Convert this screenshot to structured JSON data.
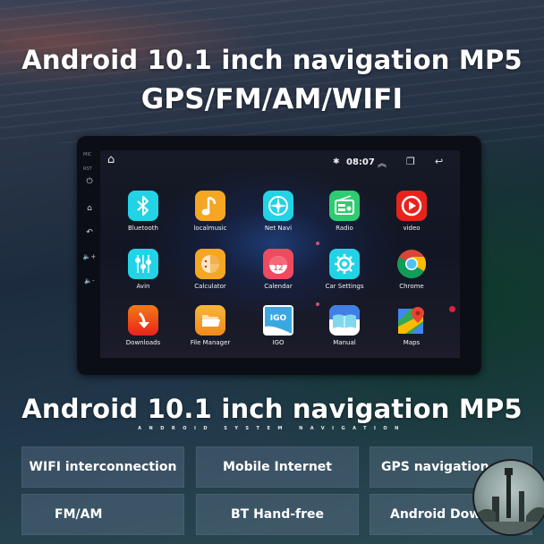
{
  "banner": {
    "headline_1": "Android 10.1 inch navigation MP5",
    "headline_2": "GPS/FM/AM/WIFI"
  },
  "device": {
    "side_buttons": [
      {
        "icon": "power-icon",
        "glyph": "⏻"
      },
      {
        "icon": "home-icon",
        "glyph": "⌂"
      },
      {
        "icon": "back-icon",
        "glyph": "↶"
      },
      {
        "icon": "volume-up-icon",
        "glyph": "🔈+"
      },
      {
        "icon": "volume-down-icon",
        "glyph": "🔈-"
      }
    ],
    "side_labels": [
      "MIC",
      "RST"
    ],
    "status_bar": {
      "home_glyph": "⌂",
      "bluetooth_glyph": "✱",
      "time": "08:07",
      "expand_glyph": "︽",
      "recents_glyph": "❐",
      "back_glyph": "↩"
    },
    "apps": [
      {
        "label": "Bluetooth",
        "icon": "bluetooth-icon",
        "color": "#22d3e6"
      },
      {
        "label": "localmusic",
        "icon": "music-note-icon",
        "color": "#f5a623"
      },
      {
        "label": "Net Navi",
        "icon": "compass-icon",
        "color": "#22d3e6"
      },
      {
        "label": "Radio",
        "icon": "radio-icon",
        "color": "#2ecc71"
      },
      {
        "label": "video",
        "icon": "play-icon",
        "color": "#e8231c"
      },
      {
        "label": "Avin",
        "icon": "equalizer-icon",
        "color": "#22d3e6"
      },
      {
        "label": "Calculator",
        "icon": "calculator-icon",
        "color": "#f5a623"
      },
      {
        "label": "Calendar",
        "icon": "calendar-icon",
        "color": "#ef4a5e"
      },
      {
        "label": "Car Settings",
        "icon": "gear-icon",
        "color": "#22d3e6"
      },
      {
        "label": "Chrome",
        "icon": "chrome-icon",
        "color": "#4285f4"
      },
      {
        "label": "Downloads",
        "icon": "download-arrow-icon",
        "color": "#f35a14"
      },
      {
        "label": "File Manager",
        "icon": "folder-icon",
        "color": "#f5a623"
      },
      {
        "label": "IGO",
        "icon": "igo-icon",
        "color": "#3aa8e0"
      },
      {
        "label": "Manual",
        "icon": "book-icon",
        "color": "#3fa7e6"
      },
      {
        "label": "Maps",
        "icon": "map-pin-icon",
        "color": "#34a853"
      }
    ],
    "calendar_number": "12",
    "igo_text": "IGO"
  },
  "section": {
    "title": "Android 10.1 inch navigation MP5",
    "subtitle": "ANDROID SYSTEM NAVIGATION"
  },
  "features": [
    "WIFI interconnection",
    "Mobile Internet",
    "GPS navigation",
    "FM/AM",
    "BT Hand-free",
    "Android Dow..."
  ]
}
